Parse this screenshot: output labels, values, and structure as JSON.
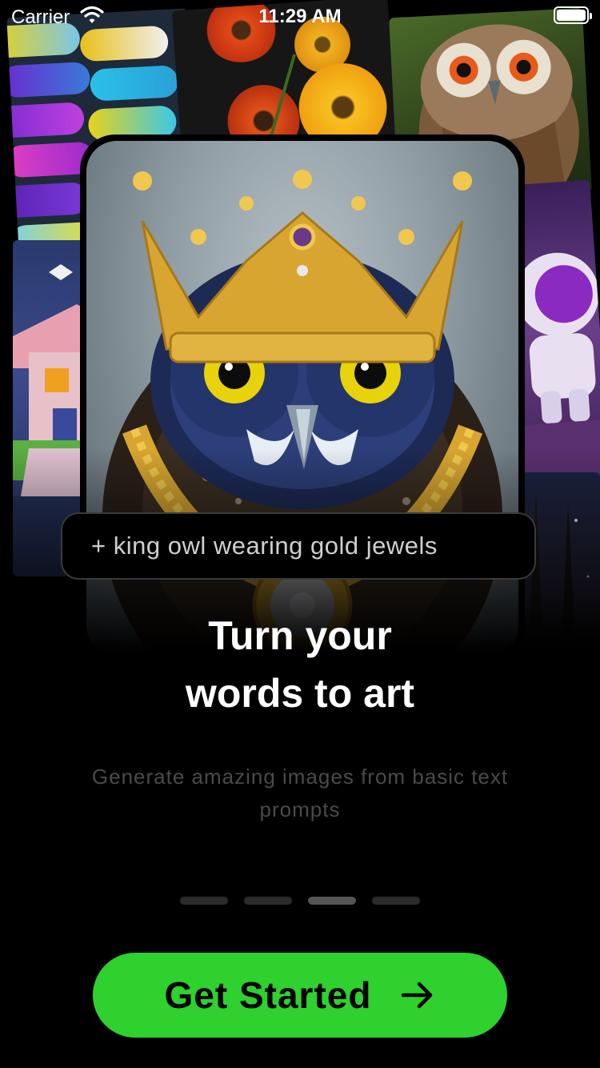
{
  "status_bar": {
    "carrier": "Carrier",
    "time": "11:29 AM",
    "icons": [
      "wifi-icon",
      "battery-icon"
    ]
  },
  "collage": {
    "tiles": [
      "capsules",
      "flowers",
      "owl",
      "isometric-house",
      "astronaut",
      "night-scene"
    ],
    "hero_image": "king-owl-crown"
  },
  "prompt": {
    "text": "+ king owl wearing gold jewels"
  },
  "onboarding": {
    "title_line1": "Turn your",
    "title_line2": "words to art",
    "subtitle_line1": "Generate amazing images from basic text",
    "subtitle_line2": "prompts"
  },
  "pager": {
    "total": 4,
    "current_page": 3
  },
  "cta": {
    "label": "Get Started",
    "icon": "arrow-right-icon"
  },
  "colors": {
    "background": "#000000",
    "accent": "#2ed12e",
    "title": "#ffffff",
    "subtitle": "#4a4a4a"
  }
}
